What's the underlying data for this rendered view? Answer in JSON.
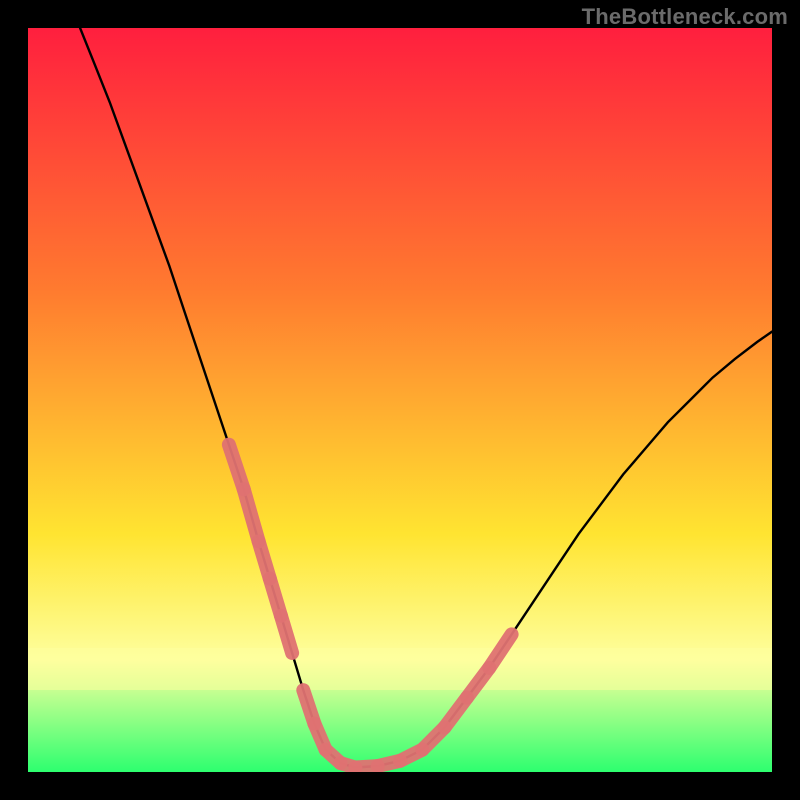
{
  "watermark": "TheBottleneck.com",
  "colors": {
    "gradient_top": "#ff1f3e",
    "gradient_mid1": "#ff7a2f",
    "gradient_mid2": "#ffe431",
    "gradient_band": "#feff9e",
    "gradient_bottom": "#2dff6f",
    "curve": "#000000",
    "marker": "#e07272",
    "frame_bg": "#000000"
  },
  "chart_data": {
    "type": "line",
    "title": "",
    "xlabel": "",
    "ylabel": "",
    "xlim": [
      0,
      100
    ],
    "ylim": [
      0,
      100
    ],
    "series": [
      {
        "name": "bottleneck-curve",
        "x": [
          7,
          9,
          11,
          13,
          15,
          17,
          19,
          21,
          23,
          25,
          27,
          29,
          31,
          32.5,
          34,
          35.5,
          37,
          38.5,
          40,
          42,
          44,
          47,
          50,
          53,
          56,
          59,
          62,
          65,
          68,
          71,
          74,
          77,
          80,
          83,
          86,
          89,
          92,
          95,
          98,
          100
        ],
        "y": [
          100,
          95,
          90,
          84.5,
          79,
          73.5,
          68,
          62,
          56,
          50,
          44,
          38,
          31,
          26,
          21,
          16,
          11,
          6.5,
          3,
          1.2,
          0.6,
          0.8,
          1.5,
          3,
          6,
          10,
          14,
          18.5,
          23,
          27.5,
          32,
          36,
          40,
          43.5,
          47,
          50,
          53,
          55.5,
          57.8,
          59.2
        ]
      }
    ],
    "highlight_segments": [
      {
        "name": "left-strip",
        "x": [
          27,
          29,
          31,
          32.5,
          34,
          35.5
        ],
        "y": [
          44,
          38,
          31,
          26,
          21,
          16
        ]
      },
      {
        "name": "valley-floor",
        "x": [
          37,
          38.5,
          40,
          42,
          44,
          47,
          50
        ],
        "y": [
          11,
          6.5,
          3,
          1.2,
          0.6,
          0.8,
          1.5
        ]
      },
      {
        "name": "right-strip",
        "x": [
          50,
          53,
          56,
          59,
          62,
          65
        ],
        "y": [
          1.5,
          3,
          6,
          10,
          14,
          18.5
        ]
      }
    ]
  }
}
